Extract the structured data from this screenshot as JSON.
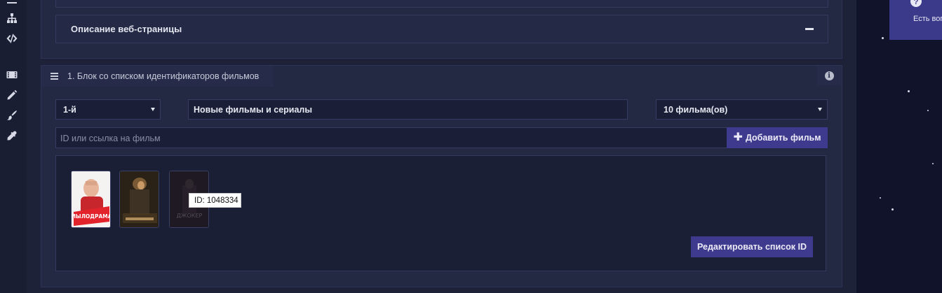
{
  "description_section": {
    "title": "Описание веб-страницы",
    "toggle_icon": "minus-icon"
  },
  "block": {
    "title": "1. Блок со списком идентификаторов фильмов",
    "menu_icon": "hamburger-icon",
    "info_icon": "info-icon",
    "info_glyph": "i",
    "position_select": {
      "value": "1-й"
    },
    "block_name": {
      "value": "Новые фильмы и сериалы"
    },
    "count_select": {
      "value": "10 фильма(ов)"
    },
    "film_input": {
      "placeholder": "ID или ссылка на фильм"
    },
    "add_button": {
      "label": "Добавить фильм",
      "icon": "plus-icon"
    },
    "edit_button": {
      "label": "Редактировать список ID"
    },
    "tooltip": "ID: 1048334",
    "posters": [
      {
        "name": "Мылодрама",
        "title_text": "МЫЛОДРАМА"
      },
      {
        "name": "Dark poster",
        "title_text": ""
      },
      {
        "name": "Джокер",
        "title_text": "ДЖОКЕР"
      }
    ]
  },
  "help_widget": {
    "label": "Есть воп",
    "icon": "question-icon"
  },
  "sidebar_icons": [
    "list-icon",
    "sitemap-icon",
    "code-icon",
    "film-icon",
    "pencil-icon",
    "brush-icon",
    "eyedropper-icon"
  ],
  "colors": {
    "accent": "#3e3b8e",
    "background": "#161a2e",
    "panel": "#232843"
  }
}
